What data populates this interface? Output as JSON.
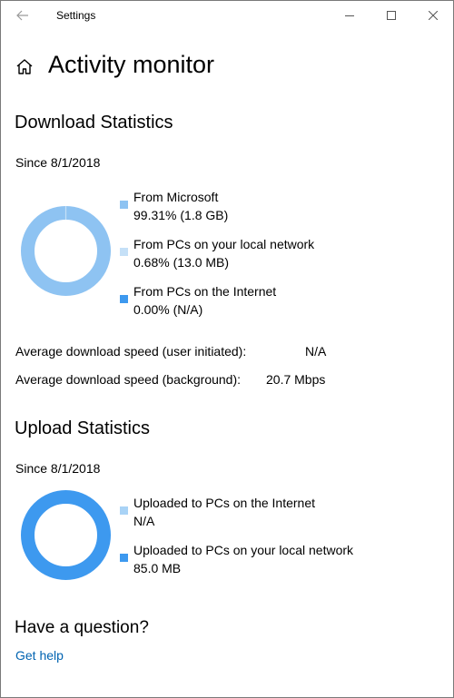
{
  "window": {
    "title": "Settings"
  },
  "header": {
    "page_title": "Activity monitor"
  },
  "download": {
    "section_title": "Download Statistics",
    "since": "Since 8/1/2018",
    "legend": [
      {
        "label": "From Microsoft",
        "value": "99.31%  (1.8 GB)",
        "color": "#8ec3f2",
        "percent": 99.31
      },
      {
        "label": "From PCs on your local network",
        "value": "0.68%  (13.0 MB)",
        "color": "#c5e0f7",
        "percent": 0.68
      },
      {
        "label": "From PCs on the Internet",
        "value": "0.00%  (N/A)",
        "color": "#3d99ef",
        "percent": 0.0
      }
    ],
    "avg_user_label": "Average download speed (user initiated):",
    "avg_user_value": "N/A",
    "avg_bg_label": "Average download speed (background):",
    "avg_bg_value": "20.7 Mbps"
  },
  "upload": {
    "section_title": "Upload Statistics",
    "since": "Since 8/1/2018",
    "legend": [
      {
        "label": "Uploaded to PCs on the Internet",
        "value": "N/A",
        "color": "#a9d3f6",
        "percent": 0
      },
      {
        "label": "Uploaded to PCs on your local network",
        "value": "85.0 MB",
        "color": "#3d99ef",
        "percent": 100
      }
    ]
  },
  "help": {
    "title": "Have a question?",
    "link": "Get help"
  },
  "icons": {
    "back": "back-arrow-icon",
    "home": "home-icon",
    "minimize": "minimize-icon",
    "maximize": "maximize-icon",
    "close": "close-icon"
  }
}
